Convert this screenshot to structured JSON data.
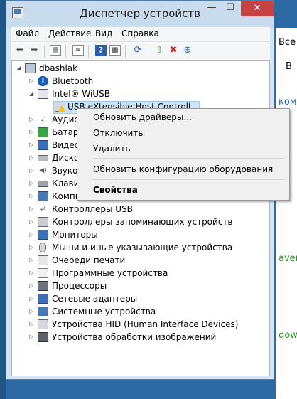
{
  "window": {
    "title": "Диспетчер устройств"
  },
  "title_buttons": {
    "minimize": "—",
    "maximize": "☐",
    "close": "✕"
  },
  "menu": [
    "Файл",
    "Действие",
    "Вид",
    "Справка"
  ],
  "tree": {
    "root": "dbashlak",
    "items": [
      {
        "label": "Bluetooth",
        "icon": "bluetooth-icon",
        "expanded": false
      },
      {
        "label": "Intel® WiUSB",
        "icon": "network-icon",
        "expanded": true
      },
      {
        "label": "USB eXtensible Host Controller",
        "icon": "usb-warning-icon",
        "selected": true
      },
      {
        "label": "Аудиовходы и аудиовыходы",
        "icon": "audio-icon",
        "expanded": false
      },
      {
        "label": "Батареи",
        "icon": "battery-icon",
        "expanded": false
      },
      {
        "label": "Видеоадаптеры",
        "icon": "display-adapter-icon",
        "expanded": false
      },
      {
        "label": "Дисковые устройства",
        "icon": "disk-icon",
        "expanded": false
      },
      {
        "label": "Звуковые устройства",
        "icon": "sound-icon",
        "expanded": false
      },
      {
        "label": "Клавиатуры",
        "icon": "keyboard-icon",
        "expanded": false
      },
      {
        "label": "Компьютер",
        "icon": "computer-icon",
        "expanded": false
      },
      {
        "label": "Контроллеры USB",
        "icon": "usb-controller-icon",
        "expanded": false
      },
      {
        "label": "Контроллеры запоминающих устройств",
        "icon": "storage-controller-icon",
        "expanded": false
      },
      {
        "label": "Мониторы",
        "icon": "monitor-icon",
        "expanded": false
      },
      {
        "label": "Мыши и иные указывающие устройства",
        "icon": "mouse-icon",
        "expanded": false
      },
      {
        "label": "Очереди печати",
        "icon": "printer-icon",
        "expanded": false
      },
      {
        "label": "Программные устройства",
        "icon": "software-device-icon",
        "expanded": false
      },
      {
        "label": "Процессоры",
        "icon": "cpu-icon",
        "expanded": false
      },
      {
        "label": "Сетевые адаптеры",
        "icon": "network-adapter-icon",
        "expanded": false
      },
      {
        "label": "Системные устройства",
        "icon": "system-device-icon",
        "expanded": false
      },
      {
        "label": "Устройства HID (Human Interface Devices)",
        "icon": "hid-icon",
        "expanded": false
      },
      {
        "label": "Устройства обработки изображений",
        "icon": "imaging-icon",
        "expanded": false
      }
    ]
  },
  "context_menu": {
    "update_drivers": "Обновить драйверы...",
    "disable": "Отключить",
    "uninstall": "Удалить",
    "scan_hardware": "Обновить конфигурацию оборудования",
    "properties": "Свойства"
  },
  "background_fragments": [
    "Все",
    "В",
    "ком",
    "aver",
    "dows"
  ],
  "colors": {
    "accent": "#2d6aa3",
    "close": "#c74343",
    "selection": "#cce4f7",
    "link_green": "#2e8b2e"
  }
}
